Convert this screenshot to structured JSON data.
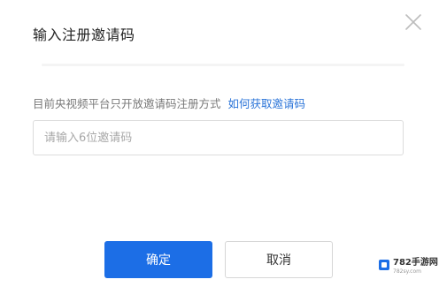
{
  "dialog": {
    "title": "输入注册邀请码",
    "close_icon": "close-icon"
  },
  "info": {
    "text": "目前央视频平台只开放邀请码注册方式",
    "link": "如何获取邀请码"
  },
  "invite_input": {
    "value": "",
    "placeholder": "请输入6位邀请码"
  },
  "buttons": {
    "confirm_label": "确定",
    "cancel_label": "取消"
  },
  "watermark": {
    "main": "782手游网",
    "sub": "782sy.com"
  },
  "colors": {
    "primary": "#1c6ee6",
    "link": "#2b74d8",
    "title": "#222222",
    "muted": "#777777"
  }
}
